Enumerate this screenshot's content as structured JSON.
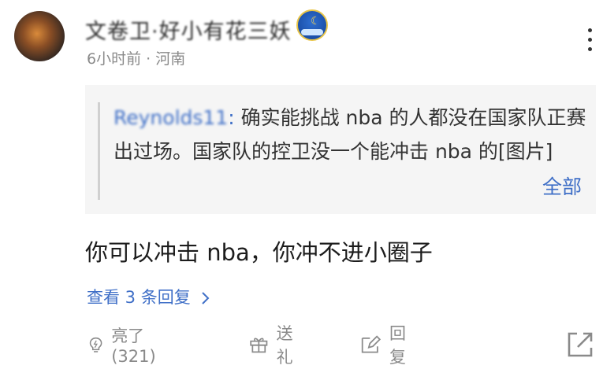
{
  "comment": {
    "username": "文卷卫·好小有花三妖",
    "time": "6小时前",
    "location": "河南",
    "meta_sep": " · ",
    "quote": {
      "author": "Reynolds11",
      "text": "确实能挑战 nba 的人都没在国家队正赛出过场。国家队的控卫没一个能冲击 nba 的[图片]",
      "expand_label": "全部"
    },
    "body": "你可以冲击 nba，你冲不进小圈子",
    "view_replies_label": "查看 3 条回复",
    "actions": {
      "like_label": "亮了 (321)",
      "gift_label": "送礼",
      "reply_label": "回复"
    }
  },
  "colors": {
    "accent": "#3f6fc7",
    "muted": "#8a8a8a",
    "quote_bg": "#f5f5f5"
  },
  "icons": [
    "more-vertical-icon",
    "lightbulb-icon",
    "gift-icon",
    "edit-reply-icon",
    "share-icon",
    "user-badge-icon"
  ]
}
